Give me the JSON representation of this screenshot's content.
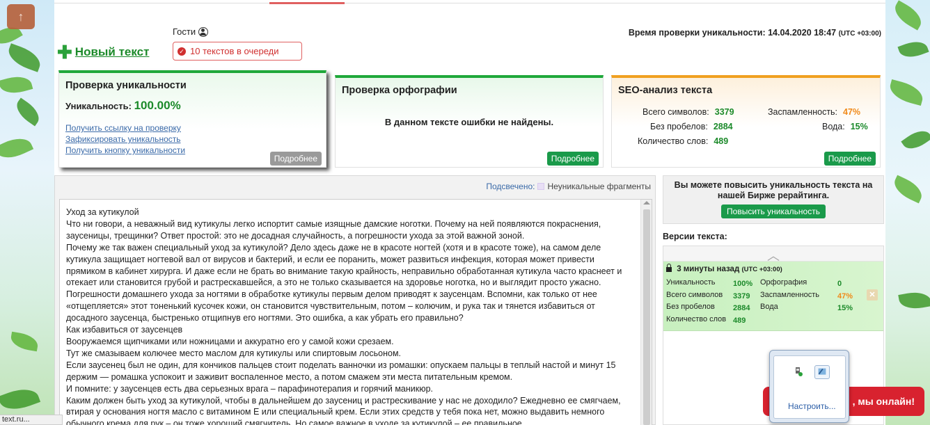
{
  "scroll_top_icon": "arrow-up-icon",
  "new_text": {
    "label": "Новый текст",
    "icon": "plus-icon"
  },
  "guests": {
    "label": "Гости",
    "icon": "user-icon"
  },
  "queue": {
    "label": "10 текстов в очереди",
    "icon": "check-circle-icon"
  },
  "check_time": {
    "label": "Время проверки уникальности: 14.04.2020 18:47",
    "tz": "(UTC +03:00)"
  },
  "card_uniqueness": {
    "title": "Проверка уникальности",
    "uniq_label": "Уникальность:",
    "uniq_value": "100.00%",
    "links": [
      "Получить ссылку на проверку",
      "Зафиксировать уникальность",
      "Получить кнопку уникальности"
    ],
    "more": "Подробнее"
  },
  "card_spelling": {
    "title": "Проверка орфографии",
    "message": "В данном тексте ошибки не найдены.",
    "more": "Подробнее"
  },
  "card_seo": {
    "title": "SEO-анализ текста",
    "total_chars_label": "Всего символов:",
    "total_chars": "3379",
    "no_spaces_label": "Без пробелов:",
    "no_spaces": "2884",
    "words_label": "Количество слов:",
    "words": "489",
    "spam_label": "Заспамленность:",
    "spam": "47%",
    "water_label": "Вода:",
    "water": "15%",
    "more": "Подробнее"
  },
  "legend": {
    "highlighted": "Подсвечено:",
    "label": "Неуникальные фрагменты"
  },
  "text_lines": [
    "Уход за кутикулой",
    "Что ни говори, а неважный вид кутикулы легко испортит самые изящные дамские ноготки. Почему на ней появляются покраснения, заусеницы, трещинки? Ответ простой: это не досадная случайность, а погрешности ухода за этой важной зоной.",
    "Почему же так важен специальный уход за кутикулой? Дело здесь даже не в красоте ногтей (хотя и в красоте тоже), на самом деле кутикула защищает ногтевой вал от вирусов и бактерий, и если ее поранить, может развиться инфекция, которая может привести прямиком в кабинет хирурга. И даже если не брать во внимание такую крайность, неправильно обработанная кутикула часто краснеет и отекает или становится грубой и растрескавшейся, а это не только сказывается на здоровье ноготка, но и выглядит просто ужасно.",
    "Погрешности домашнего ухода за ногтями в обработке кутикулы первым делом приводят к заусенцам. Вспомни, как только от нее «отщепляется» этот тоненький кусочек кожи, он становится чувствительным, потом – колючим, и рука так и тянется избавиться от досадного заусенца, быстренько отщипнув его ногтями. Это ошибка, а как убрать его правильно?",
    "Как избавиться от заусенцев",
    "Вооружаемся щипчиками или ножницами и аккуратно его у самой кожи срезаем.",
    "Тут же смазываем колючее место маслом для кутикулы или спиртовым лосьоном.",
    "Если заусенец был не один, для кончиков пальцев стоит поделать ванночки из ромашки: опускаем пальцы в теплый настой и минут 15 держим — ромашка успокоит и заживит воспаленное место, а потом смажем эти места питательным кремом.",
    "И помните: у заусенцев есть два серьезных врага – парафинотерапия и горячий маникюр.",
    "Каким должен быть уход за кутикулой, чтобы в дальнейшем до заусениц и растрескивание у нас не доходило? Ежедневно ее смягчаем, втирая у основания ногтя масло с витамином Е или специальный крем. Если этих средств у тебя пока нет, можно выдавить немного обычного крема для рук – он тоже хороший смягчитель. Но самое важное в уходе за кутикулой – ее правильное"
  ],
  "promo": {
    "text": "Вы можете повысить уникальность текста на нашей Бирже рерайтинга.",
    "button": "Повысить уникальность"
  },
  "versions": {
    "title": "Версии текста:",
    "item": {
      "time": "3 минуты назад",
      "tz": "(UTC +03:00)",
      "uniq_label": "Уникальность",
      "uniq": "100%",
      "chars_label": "Всего символов",
      "chars": "3379",
      "no_spaces_label": "Без пробелов",
      "no_spaces": "2884",
      "words_label": "Количество слов",
      "words": "489",
      "spelling_label": "Орфография",
      "spelling": "0",
      "spam_label": "Заспамленность",
      "spam": "47%",
      "water_label": "Вода",
      "water": "15%"
    }
  },
  "tray": {
    "link": "Настроить..."
  },
  "chat": {
    "label": ", мы онлайн!"
  },
  "status_url": "text.ru...",
  "colors": {
    "green": "#1c8a2a",
    "orange": "#f08a1a",
    "accent": "#1a9a4a",
    "red": "#d8222f"
  }
}
